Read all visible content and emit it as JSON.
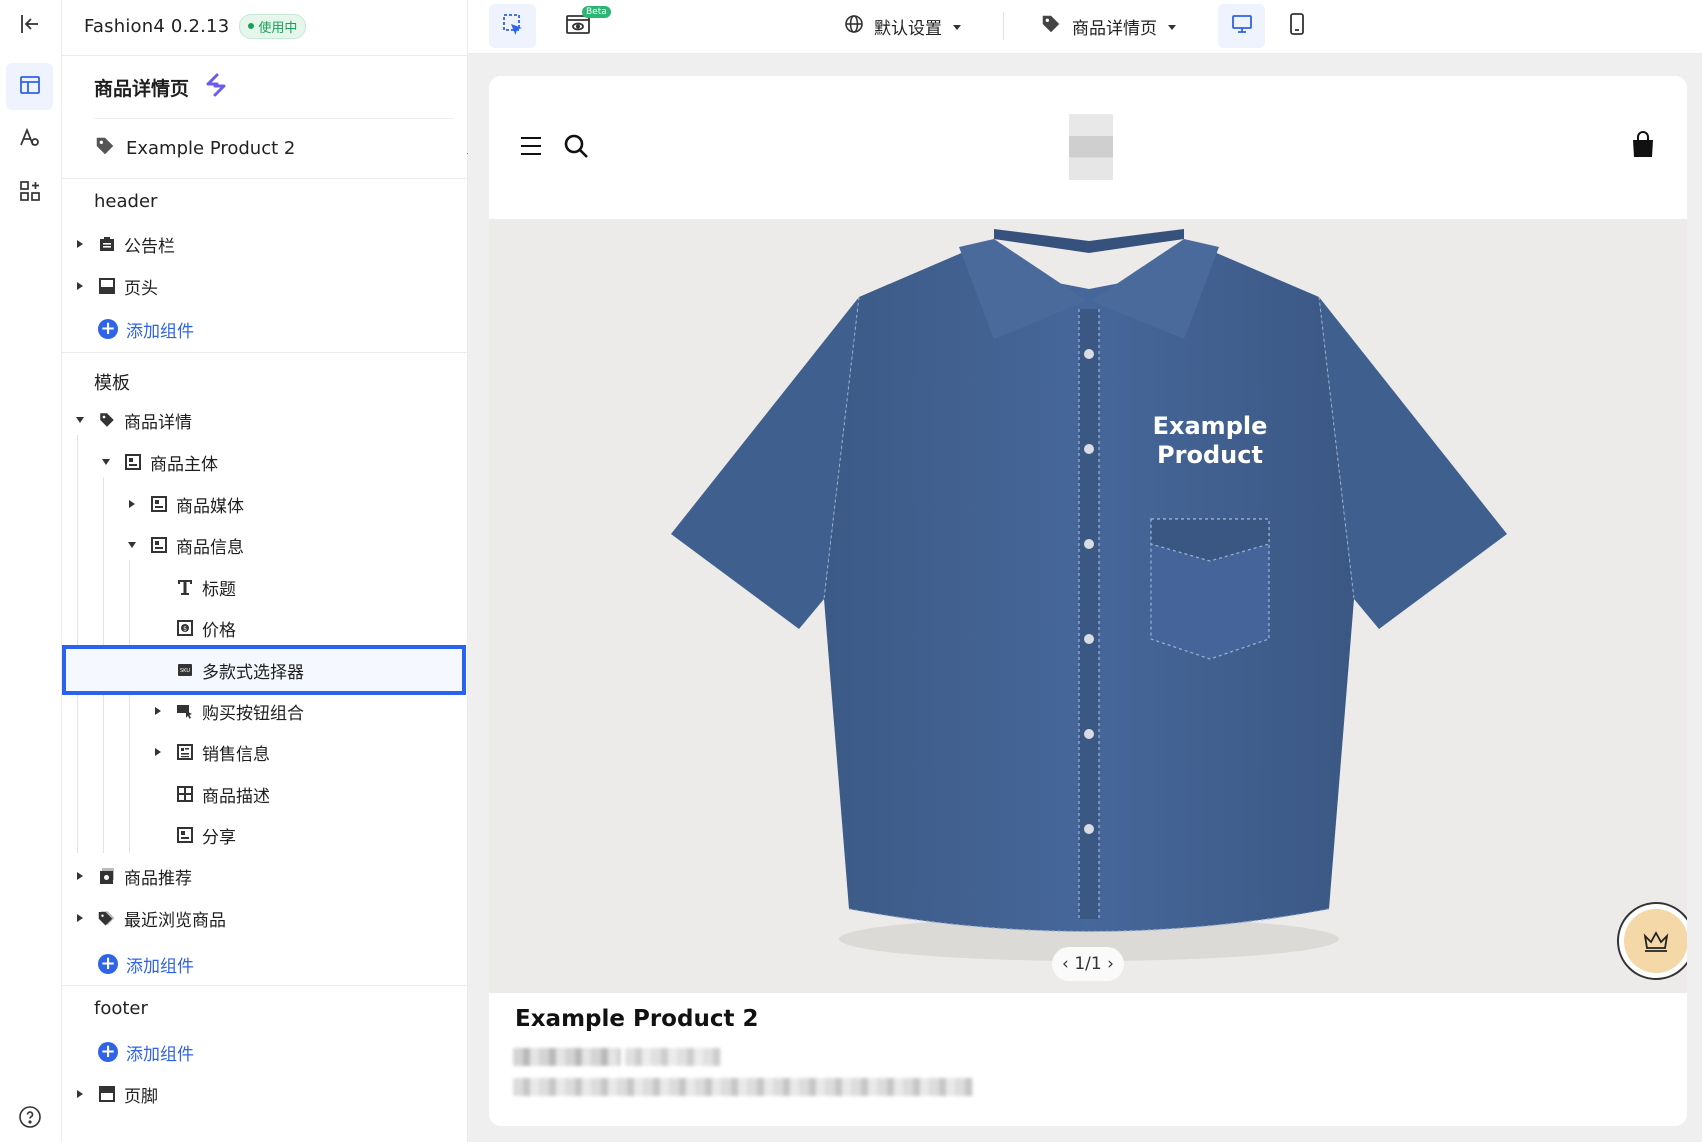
{
  "app": {
    "name": "Fashion4 0.2.13",
    "status": "使用中"
  },
  "sidebar": {
    "page_title": "商品详情页",
    "selected_product": "Example Product 2",
    "header_section": "header",
    "header_items": [
      {
        "label": "公告栏"
      },
      {
        "label": "页头"
      }
    ],
    "add_component": "添加组件",
    "template_section": "模板",
    "template_items": [
      {
        "label": "商品详情"
      },
      {
        "label": "商品主体"
      },
      {
        "label": "商品媒体"
      },
      {
        "label": "商品信息"
      },
      {
        "label": "标题"
      },
      {
        "label": "价格"
      },
      {
        "label": "多款式选择器"
      },
      {
        "label": "购买按钮组合"
      },
      {
        "label": "销售信息"
      },
      {
        "label": "商品描述"
      },
      {
        "label": "分享"
      },
      {
        "label": "商品推荐"
      },
      {
        "label": "最近浏览商品"
      }
    ],
    "footer_section": "footer",
    "footer_items": [
      {
        "label": "页脚"
      }
    ]
  },
  "toolbar": {
    "beta_badge": "Beta",
    "language_select": "默认设置",
    "page_select": "商品详情页"
  },
  "preview": {
    "hero_text": "Example Product",
    "hero_text_line1": "Example",
    "hero_text_line2": "Product",
    "pager": "1/1",
    "product_title": "Example Product 2"
  },
  "colors": {
    "accent": "#2f63e8",
    "highlight": "#2a63f0",
    "status": "#18a058",
    "denim": "#3f5f8e"
  }
}
